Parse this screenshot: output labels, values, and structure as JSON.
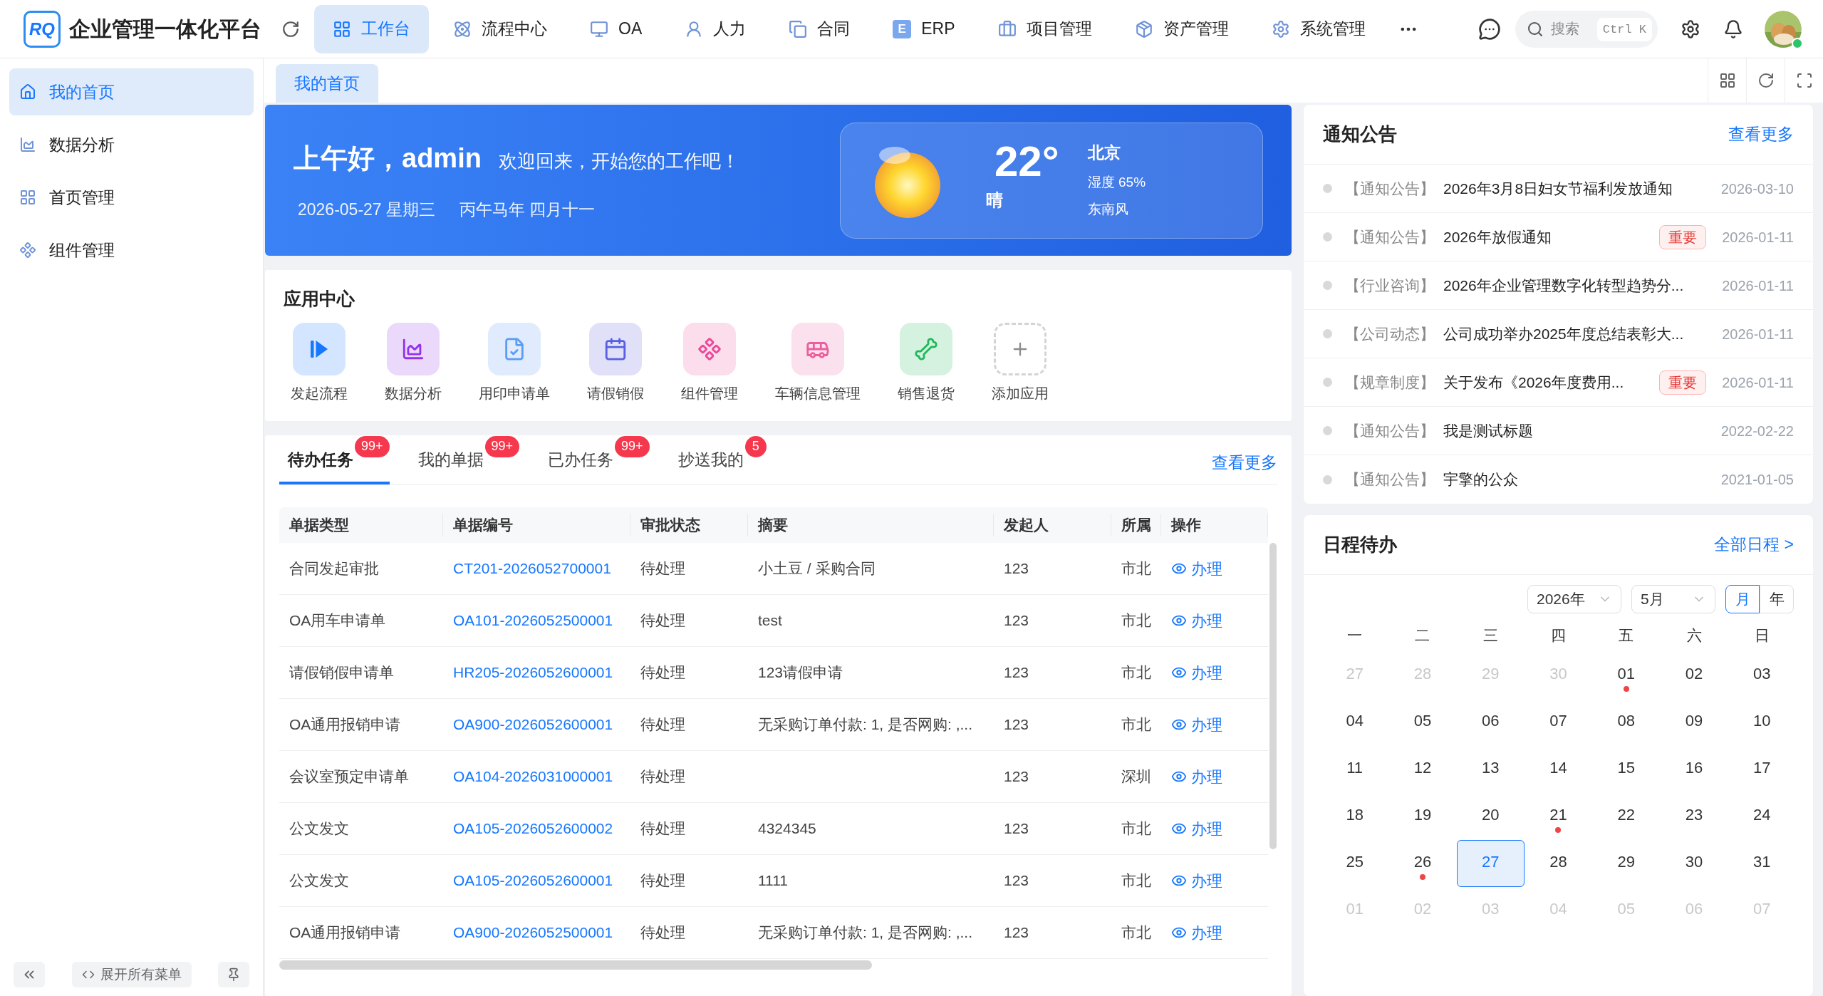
{
  "header": {
    "logo_text": "RQ",
    "title": "企业管理一体化平台",
    "nav": [
      {
        "label": "工作台",
        "selected": true
      },
      {
        "label": "流程中心",
        "selected": false
      },
      {
        "label": "OA",
        "selected": false
      },
      {
        "label": "人力",
        "selected": false
      },
      {
        "label": "合同",
        "selected": false
      },
      {
        "label": "ERP",
        "icon_letter": "E",
        "selected": false
      },
      {
        "label": "项目管理",
        "selected": false
      },
      {
        "label": "资产管理",
        "selected": false
      },
      {
        "label": "系统管理",
        "selected": false
      }
    ],
    "search": {
      "placeholder": "搜索",
      "shortcut": "Ctrl K"
    },
    "user": {
      "online": true
    }
  },
  "sidebar": {
    "items": [
      {
        "label": "我的首页",
        "selected": true
      },
      {
        "label": "数据分析",
        "selected": false
      },
      {
        "label": "首页管理",
        "selected": false
      },
      {
        "label": "组件管理",
        "selected": false
      }
    ],
    "expand_label": "展开所有菜单"
  },
  "page_tabs": [
    {
      "label": "我的首页",
      "selected": true
    }
  ],
  "banner": {
    "greeting": "上午好，admin",
    "subtitle": "欢迎回来，开始您的工作吧！",
    "date": "2026-05-27 星期三",
    "lunar": "丙午马年 四月十一",
    "weather": {
      "temp": "22°",
      "condition": "晴",
      "city": "北京",
      "humidity": "湿度 65%",
      "wind": "东南风"
    }
  },
  "apps": {
    "title": "应用中心",
    "items": [
      {
        "label": "发起流程",
        "kind": "play",
        "color": "#1677ff"
      },
      {
        "label": "数据分析",
        "kind": "chart",
        "color": "#9333ea"
      },
      {
        "label": "用印申请单",
        "kind": "file",
        "color": "#5b9cf5"
      },
      {
        "label": "请假销假",
        "kind": "calendar",
        "color": "#5a5fe0"
      },
      {
        "label": "组件管理",
        "kind": "component",
        "color": "#ec4899"
      },
      {
        "label": "车辆信息管理",
        "kind": "bus",
        "color": "#ec5f9f"
      },
      {
        "label": "销售退货",
        "kind": "bone",
        "color": "#22b85a"
      },
      {
        "label": "添加应用",
        "kind": "add",
        "color": "#8c8c8c"
      }
    ]
  },
  "tasks": {
    "tabs": [
      {
        "label": "待办任务",
        "count": "99+",
        "selected": true
      },
      {
        "label": "我的单据",
        "count": "99+",
        "selected": false
      },
      {
        "label": "已办任务",
        "count": "99+",
        "selected": false
      },
      {
        "label": "抄送我的",
        "count": "5",
        "selected": false
      }
    ],
    "more": "查看更多",
    "columns": [
      "单据类型",
      "单据编号",
      "审批状态",
      "摘要",
      "发起人",
      "所属",
      "操作"
    ],
    "rows": [
      {
        "type": "合同发起审批",
        "number": "CT201-2026052700001",
        "status": "待处理",
        "summary": "小土豆 / 采购合同",
        "initiator": "123",
        "company": "市北",
        "action": "办理"
      },
      {
        "type": "OA用车申请单",
        "number": "OA101-2026052500001",
        "status": "待处理",
        "summary": "test",
        "initiator": "123",
        "company": "市北",
        "action": "办理"
      },
      {
        "type": "请假销假申请单",
        "number": "HR205-2026052600001",
        "status": "待处理",
        "summary": "123请假申请",
        "initiator": "123",
        "company": "市北",
        "action": "办理"
      },
      {
        "type": "OA通用报销申请",
        "number": "OA900-2026052600001",
        "status": "待处理",
        "summary": "无采购订单付款: 1, 是否网购: ,...",
        "initiator": "123",
        "company": "市北",
        "action": "办理"
      },
      {
        "type": "会议室预定申请单",
        "number": "OA104-2026031000001",
        "status": "待处理",
        "initiator": "123",
        "company": "深圳",
        "action": "办理"
      },
      {
        "type": "公文发文",
        "number": "OA105-2026052600002",
        "status": "待处理",
        "summary": "4324345",
        "initiator": "123",
        "company": "市北",
        "action": "办理"
      },
      {
        "type": "公文发文",
        "number": "OA105-2026052600001",
        "status": "待处理",
        "summary": "1111",
        "initiator": "123",
        "company": "市北",
        "action": "办理"
      },
      {
        "type": "OA通用报销申请",
        "number": "OA900-2026052500001",
        "status": "待处理",
        "summary": "无采购订单付款: 1, 是否网购: ,...",
        "initiator": "123",
        "company": "市北",
        "action": "办理"
      }
    ]
  },
  "notices": {
    "title": "通知公告",
    "more": "查看更多",
    "items": [
      {
        "category": "【通知公告】",
        "title": "2026年3月8日妇女节福利发放通知",
        "date": "2026-03-10"
      },
      {
        "category": "【通知公告】",
        "title": "2026年放假通知",
        "tag": "重要",
        "date": "2026-01-11"
      },
      {
        "category": "【行业咨询】",
        "title": "2026年企业管理数字化转型趋势分...",
        "date": "2026-01-11"
      },
      {
        "category": "【公司动态】",
        "title": "公司成功举办2025年度总结表彰大...",
        "date": "2026-01-11"
      },
      {
        "category": "【规章制度】",
        "title": "关于发布《2026年度费用...",
        "tag": "重要",
        "date": "2026-01-11"
      },
      {
        "category": "【通知公告】",
        "title": "我是测试标题",
        "date": "2022-02-22"
      },
      {
        "category": "【通知公告】",
        "title": "宇擎的公众",
        "date": "2021-01-05"
      }
    ]
  },
  "calendar": {
    "title": "日程待办",
    "link": "全部日程 >",
    "year": "2026年",
    "month": "5月",
    "modes": [
      {
        "label": "月",
        "selected": true
      },
      {
        "label": "年",
        "selected": false
      }
    ],
    "weekdays": [
      "一",
      "二",
      "三",
      "四",
      "五",
      "六",
      "日"
    ],
    "days": [
      {
        "label": "27",
        "outside": true,
        "selected": false,
        "event": false
      },
      {
        "label": "28",
        "outside": true,
        "selected": false,
        "event": false
      },
      {
        "label": "29",
        "outside": true,
        "selected": false,
        "event": false
      },
      {
        "label": "30",
        "outside": true,
        "selected": false,
        "event": false
      },
      {
        "label": "01",
        "outside": false,
        "selected": false,
        "event": true
      },
      {
        "label": "02",
        "outside": false,
        "selected": false,
        "event": false
      },
      {
        "label": "03",
        "outside": false,
        "selected": false,
        "event": false
      },
      {
        "label": "04",
        "outside": false,
        "selected": false,
        "event": false
      },
      {
        "label": "05",
        "outside": false,
        "selected": false,
        "event": false
      },
      {
        "label": "06",
        "outside": false,
        "selected": false,
        "event": false
      },
      {
        "label": "07",
        "outside": false,
        "selected": false,
        "event": false
      },
      {
        "label": "08",
        "outside": false,
        "selected": false,
        "event": false
      },
      {
        "label": "09",
        "outside": false,
        "selected": false,
        "event": false
      },
      {
        "label": "10",
        "outside": false,
        "selected": false,
        "event": false
      },
      {
        "label": "11",
        "outside": false,
        "selected": false,
        "event": false
      },
      {
        "label": "12",
        "outside": false,
        "selected": false,
        "event": false
      },
      {
        "label": "13",
        "outside": false,
        "selected": false,
        "event": false
      },
      {
        "label": "14",
        "outside": false,
        "selected": false,
        "event": false
      },
      {
        "label": "15",
        "outside": false,
        "selected": false,
        "event": false
      },
      {
        "label": "16",
        "outside": false,
        "selected": false,
        "event": false
      },
      {
        "label": "17",
        "outside": false,
        "selected": false,
        "event": false
      },
      {
        "label": "18",
        "outside": false,
        "selected": false,
        "event": false
      },
      {
        "label": "19",
        "outside": false,
        "selected": false,
        "event": false
      },
      {
        "label": "20",
        "outside": false,
        "selected": false,
        "event": false
      },
      {
        "label": "21",
        "outside": false,
        "selected": false,
        "event": true
      },
      {
        "label": "22",
        "outside": false,
        "selected": false,
        "event": false
      },
      {
        "label": "23",
        "outside": false,
        "selected": false,
        "event": false
      },
      {
        "label": "24",
        "outside": false,
        "selected": false,
        "event": false
      },
      {
        "label": "25",
        "outside": false,
        "selected": false,
        "event": false
      },
      {
        "label": "26",
        "outside": false,
        "selected": false,
        "event": true
      },
      {
        "label": "27",
        "outside": false,
        "selected": true,
        "event": false
      },
      {
        "label": "28",
        "outside": false,
        "selected": false,
        "event": false
      },
      {
        "label": "29",
        "outside": false,
        "selected": false,
        "event": false
      },
      {
        "label": "30",
        "outside": false,
        "selected": false,
        "event": false
      },
      {
        "label": "31",
        "outside": false,
        "selected": false,
        "event": false
      },
      {
        "label": "01",
        "outside": true,
        "selected": false,
        "event": false
      },
      {
        "label": "02",
        "outside": true,
        "selected": false,
        "event": false
      },
      {
        "label": "03",
        "outside": true,
        "selected": false,
        "event": false
      },
      {
        "label": "04",
        "outside": true,
        "selected": false,
        "event": false
      },
      {
        "label": "05",
        "outside": true,
        "selected": false,
        "event": false
      },
      {
        "label": "06",
        "outside": true,
        "selected": false,
        "event": false
      },
      {
        "label": "07",
        "outside": true,
        "selected": false,
        "event": false
      }
    ]
  }
}
